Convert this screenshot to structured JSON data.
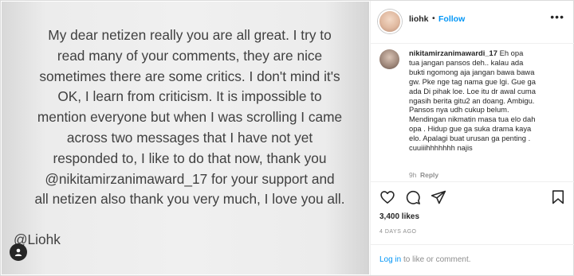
{
  "photo": {
    "caption_lines": [
      "My dear netizen really you are all great. I try to",
      "read many of your comments, they are nice",
      "sometimes there are some critics. I don't mind it's",
      "OK, I learn from criticism. It is impossible to",
      "mention everyone but when I was scrolling I came",
      "across two messages that I have not yet",
      "responded to, I like to do that now, thank you",
      "@nikitamirzanimaward_17 for your support and",
      "all netizen also thank you very much, I love you all."
    ],
    "signature": "@Liohk",
    "tag_icon": "user-tag-icon"
  },
  "header": {
    "username": "liohk",
    "separator": "•",
    "follow_label": "Follow",
    "more_label": "•••"
  },
  "comment": {
    "username": "nikitamirzanimawardi_17",
    "first_line": " Eh opa",
    "lines": [
      "tua jangan pansos deh.. kalau ada",
      "bukti ngomong aja jangan bawa bawa",
      "gw. Pke nge tag nama gue lgi. Gue ga",
      "ada Di pihak loe. Loe itu dr awal cuma",
      "ngasih berita gitu2 an doang. Ambigu.",
      "Pansos nya udh cukup belum.",
      "Mendingan nikmatin masa tua elo dah",
      "opa . Hidup gue ga suka drama kaya",
      "elo. Apalagi buat urusan ga penting .",
      "cuuiiihhhhhhh najis"
    ],
    "time": "9h",
    "reply_label": "Reply"
  },
  "actions": {
    "icons": [
      "heart-icon",
      "comment-icon",
      "share-icon",
      "bookmark-icon"
    ]
  },
  "likes": "3,400 likes",
  "date": "4 DAYS AGO",
  "login": {
    "link_label": "Log in",
    "rest": " to like or comment."
  },
  "colors": {
    "accent": "#0095f6",
    "text": "#262626",
    "muted": "#8e8e8e",
    "photo_text": "#404040"
  }
}
